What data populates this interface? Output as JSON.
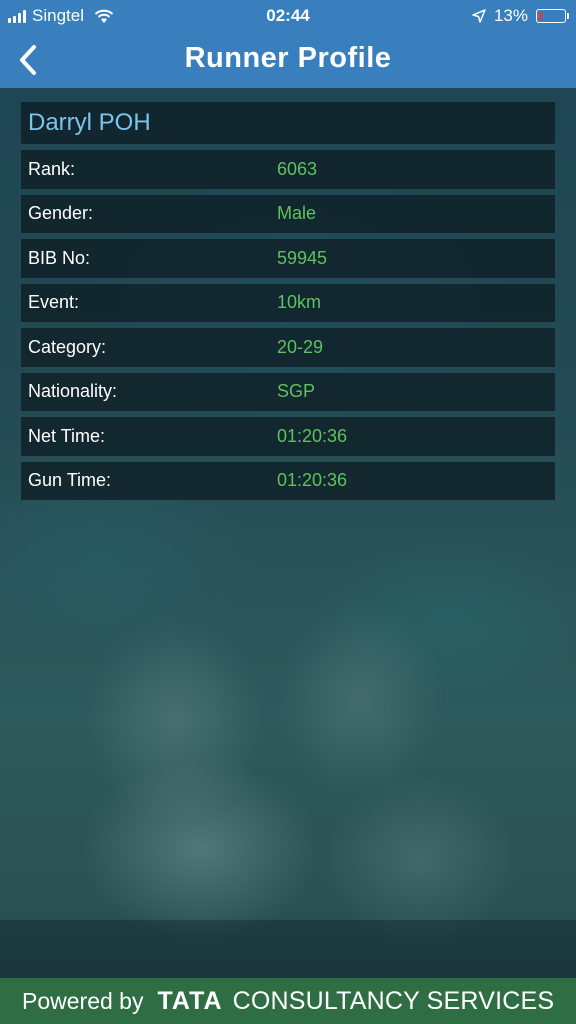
{
  "status_bar": {
    "carrier": "Singtel",
    "time": "02:44",
    "battery_percent": "13%",
    "battery_level": 0.13,
    "battery_color": "#e53935"
  },
  "nav": {
    "title": "Runner Profile",
    "back_icon": "chevron-left-icon"
  },
  "runner": {
    "name": "Darryl POH",
    "fields": [
      {
        "label": "Rank:",
        "value": "6063"
      },
      {
        "label": "Gender:",
        "value": "Male"
      },
      {
        "label": "BIB No:",
        "value": "59945"
      },
      {
        "label": "Event:",
        "value": "10km"
      },
      {
        "label": "Category:",
        "value": "20-29"
      },
      {
        "label": "Nationality:",
        "value": "SGP"
      },
      {
        "label": "Net Time:",
        "value": "01:20:36"
      },
      {
        "label": "Gun Time:",
        "value": "01:20:36"
      }
    ]
  },
  "footer": {
    "powered_by": "Powered by",
    "brand": "TATA",
    "company": "CONSULTANCY SERVICES"
  },
  "colors": {
    "header_bg": "#3a7fbd",
    "name_color": "#7cc4ea",
    "value_color": "#5ec25e",
    "footer_bg": "#2f6e45"
  }
}
